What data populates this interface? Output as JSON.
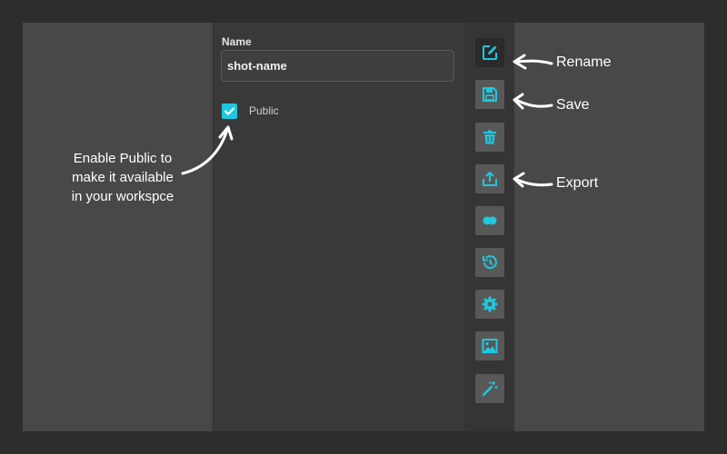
{
  "form": {
    "name_label": "Name",
    "name_value": "shot-name",
    "public_label": "Public",
    "public_checked": true
  },
  "toolbar": {
    "accent": "#1ec8de",
    "buttons": [
      {
        "icon": "edit-icon",
        "active": true
      },
      {
        "icon": "save-icon"
      },
      {
        "icon": "trash-icon"
      },
      {
        "icon": "export-icon"
      },
      {
        "icon": "toggle-dots-icon"
      },
      {
        "icon": "history-icon"
      },
      {
        "icon": "gear-icon"
      },
      {
        "icon": "image-icon"
      },
      {
        "icon": "magic-wand-icon"
      }
    ]
  },
  "annotations": {
    "rename": "Rename",
    "save": "Save",
    "export": "Export",
    "public_note": [
      "Enable Public to",
      "make it available",
      "in your workspce"
    ]
  }
}
